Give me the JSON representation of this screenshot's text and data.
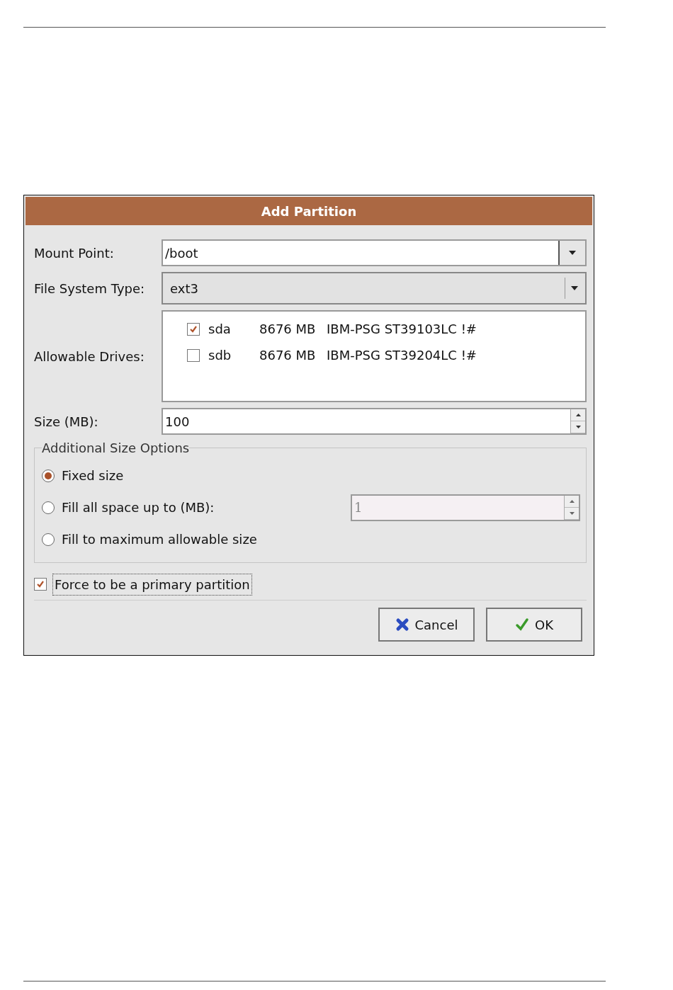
{
  "dialog": {
    "title": "Add Partition",
    "mount_point": {
      "label": "Mount Point:",
      "value": "/boot"
    },
    "file_system_type": {
      "label": "File System Type:",
      "value": "ext3"
    },
    "allowable_drives": {
      "label": "Allowable Drives:",
      "drives": [
        {
          "name": "sda",
          "size": "8676 MB",
          "model": "IBM-PSG ST39103LC !#",
          "checked": true
        },
        {
          "name": "sdb",
          "size": "8676 MB",
          "model": "IBM-PSG ST39204LC !#",
          "checked": false
        }
      ]
    },
    "size": {
      "label": "Size (MB):",
      "value": "100"
    },
    "additional_size_options": {
      "title": "Additional Size Options",
      "options": [
        {
          "label": "Fixed size",
          "selected": true
        },
        {
          "label": "Fill all space up to (MB):",
          "selected": false,
          "value": "1",
          "disabled": true
        },
        {
          "label": "Fill to maximum allowable size",
          "selected": false
        }
      ]
    },
    "force_primary": {
      "label": "Force to be a primary partition",
      "checked": true
    },
    "buttons": [
      {
        "kind": "cancel",
        "label": "Cancel"
      },
      {
        "kind": "ok",
        "label": "OK"
      }
    ]
  }
}
